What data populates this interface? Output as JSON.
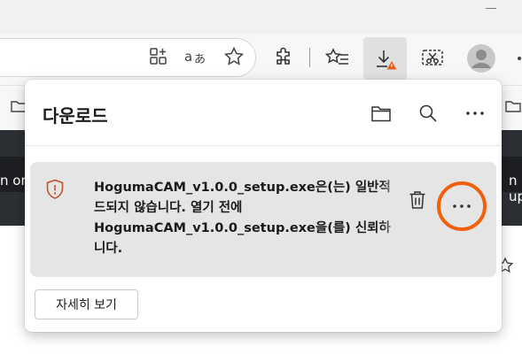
{
  "download_panel": {
    "title": "다운로드",
    "item": {
      "message_lines": [
        "HogumaCAM_v1.0.0_setup.exe은(는) 일반적",
        "드되지 않습니다. 열기 전에",
        "HogumaCAM_v1.0.0_setup.exe을(를) 신뢰하",
        "니다."
      ]
    },
    "details_label": "자세히 보기"
  },
  "page_background": {
    "left_text": "n on",
    "right_text": "n up"
  },
  "colors": {
    "highlight": "#f2600c",
    "warning": "#c0562b"
  }
}
